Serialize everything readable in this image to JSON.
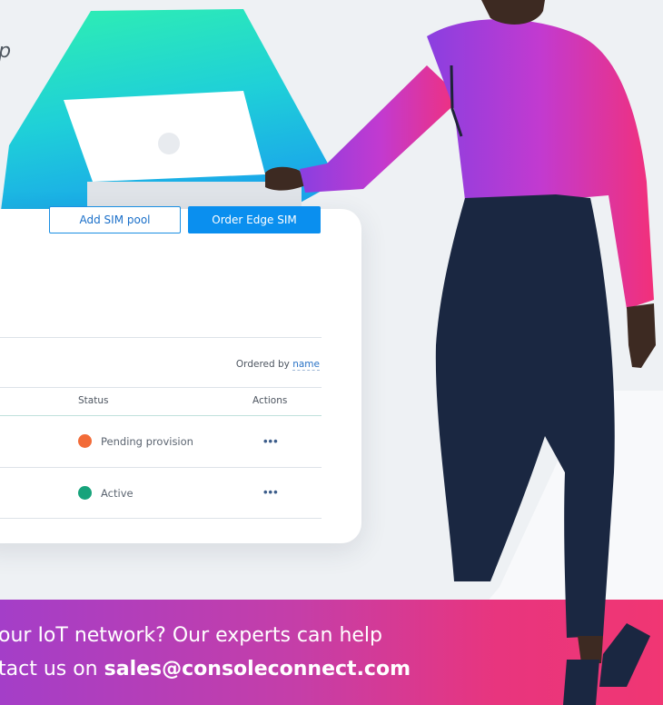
{
  "headline_fragment": "lp",
  "toolbar": {
    "add_label": "Add SIM pool",
    "order_label": "Order Edge SIM"
  },
  "sort": {
    "prefix": "Ordered by",
    "field": "name"
  },
  "table": {
    "columns": {
      "status": "Status",
      "actions": "Actions"
    },
    "rows": [
      {
        "status": "Pending provision",
        "status_color": "#f26b38",
        "actions": "•••"
      },
      {
        "status": "Active",
        "status_color": "#17a37b",
        "actions": "•••"
      }
    ]
  },
  "banner": {
    "line1": "our IoT network? Our experts can help",
    "line2_prefix": "tact us on ",
    "email": "sales@consoleconnect.com"
  },
  "colors": {
    "primary": "#0a8fef",
    "banner_start": "#a43ec8",
    "banner_end": "#f03673"
  }
}
